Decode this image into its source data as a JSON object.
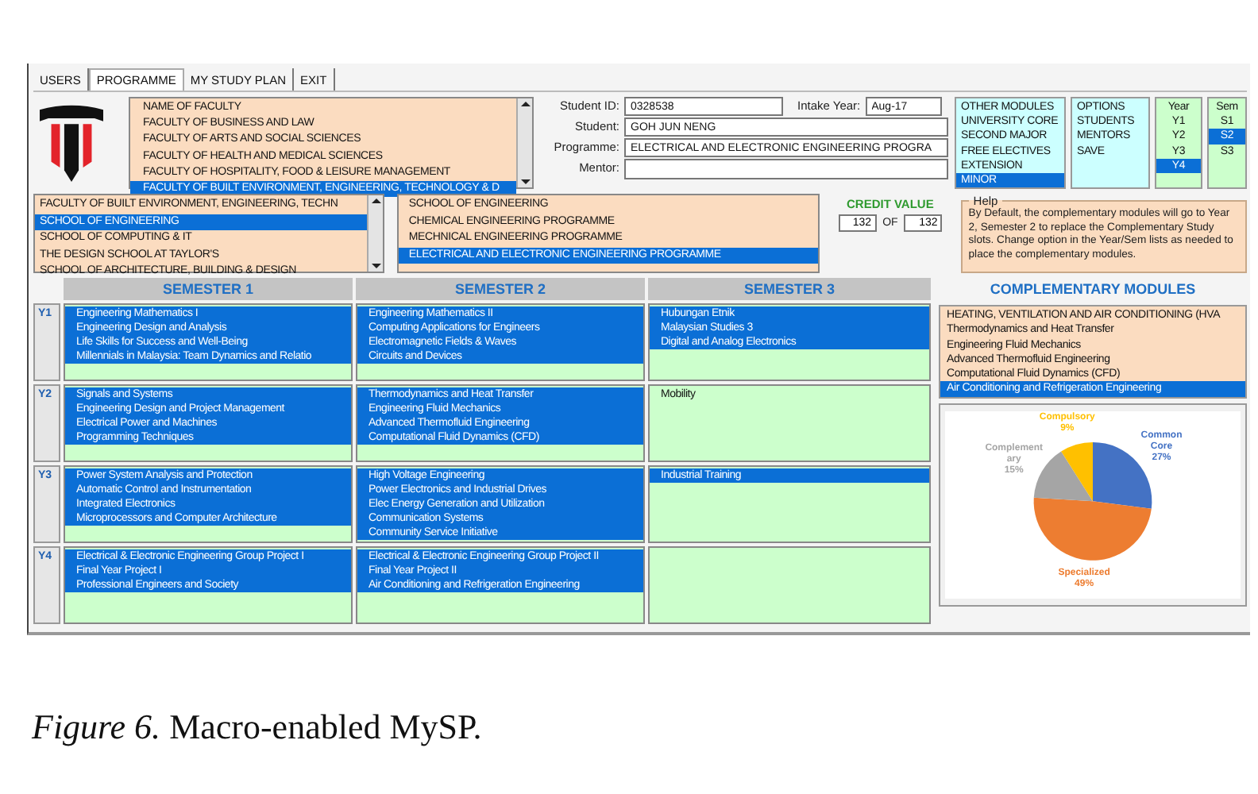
{
  "tabs": [
    {
      "label": "USERS",
      "selected": false
    },
    {
      "label": "PROGRAMME",
      "selected": true
    },
    {
      "label": "MY STUDY PLAN",
      "selected": false
    },
    {
      "label": "EXIT",
      "selected": false
    }
  ],
  "faculty_list": {
    "items": [
      {
        "label": "NAME OF FACULTY",
        "selected": false
      },
      {
        "label": "FACULTY OF BUSINESS AND LAW",
        "selected": false
      },
      {
        "label": "FACULTY OF ARTS AND SOCIAL SCIENCES",
        "selected": false
      },
      {
        "label": "FACULTY OF HEALTH AND MEDICAL SCIENCES",
        "selected": false
      },
      {
        "label": "FACULTY OF HOSPITALITY, FOOD & LEISURE MANAGEMENT",
        "selected": false
      },
      {
        "label": "FACULTY OF BUILT ENVIRONMENT, ENGINEERING, TECHNOLOGY & D",
        "selected": true
      }
    ]
  },
  "student_id": {
    "label": "Student ID:",
    "value": "0328538"
  },
  "intake_year": {
    "label": "Intake Year:",
    "value": "Aug-17"
  },
  "student": {
    "label": "Student:",
    "value": "GOH JUN NENG"
  },
  "programme": {
    "label": "Programme:",
    "value": "ELECTRICAL AND ELECTRONIC ENGINEERING PROGRA"
  },
  "mentor": {
    "label": "Mentor:"
  },
  "option_lists": [
    {
      "kind": "modules",
      "items": [
        {
          "label": "OTHER MODULES",
          "selected": false
        },
        {
          "label": "UNIVERSITY CORE",
          "selected": false
        },
        {
          "label": "SECOND MAJOR",
          "selected": false
        },
        {
          "label": "FREE ELECTIVES",
          "selected": false
        },
        {
          "label": "EXTENSION",
          "selected": false
        },
        {
          "label": "MINOR",
          "selected": true
        }
      ]
    },
    {
      "kind": "options",
      "items": [
        {
          "label": "OPTIONS",
          "selected": false
        },
        {
          "label": "STUDENTS",
          "selected": false
        },
        {
          "label": "MENTORS",
          "selected": false
        },
        {
          "label": "SAVE",
          "selected": false
        }
      ]
    },
    {
      "kind": "year",
      "items": [
        {
          "label": "Year",
          "selected": false
        },
        {
          "label": "Y1",
          "selected": false
        },
        {
          "label": "Y2",
          "selected": false
        },
        {
          "label": "Y3",
          "selected": false
        },
        {
          "label": "Y4",
          "selected": true
        }
      ]
    },
    {
      "kind": "sem",
      "items": [
        {
          "label": "Sem",
          "selected": false
        },
        {
          "label": "S1",
          "selected": false
        },
        {
          "label": "S2",
          "selected": true
        },
        {
          "label": "S3",
          "selected": false
        }
      ]
    }
  ],
  "school_list": {
    "items": [
      {
        "label": "FACULTY OF BUILT ENVIRONMENT, ENGINEERING, TECHN",
        "selected": false
      },
      {
        "label": "SCHOOL OF ENGINEERING",
        "selected": true
      },
      {
        "label": "SCHOOL OF COMPUTING & IT",
        "selected": false
      },
      {
        "label": "THE DESIGN SCHOOL AT TAYLOR'S",
        "selected": false
      },
      {
        "label": "SCHOOL OF ARCHITECTURE, BUILDING & DESIGN",
        "selected": false
      }
    ]
  },
  "programme_list": {
    "items": [
      {
        "label": "SCHOOL OF ENGINEERING",
        "selected": false
      },
      {
        "label": "CHEMICAL ENGINEERING PROGRAMME",
        "selected": false
      },
      {
        "label": "MECHNICAL ENGINEERING PROGRAMME",
        "selected": false
      },
      {
        "label": "ELECTRICAL AND ELECTRONIC ENGINEERING PROGRAMME",
        "selected": true
      }
    ]
  },
  "credit_value": {
    "label": "CREDIT VALUE",
    "earned": "132",
    "separator": "OF",
    "required": "132"
  },
  "help": {
    "title": "Help",
    "text": "By Default, the complementary modules will go to Year 2, Semester 2 to replace the Complementary Study slots. Change option in the Year/Sem lists as needed to place the complementary modules."
  },
  "plan": {
    "semesters": [
      "SEMESTER 1",
      "SEMESTER 2",
      "SEMESTER 3"
    ],
    "years": [
      {
        "label": "Y1",
        "cells": [
          [
            {
              "name": "Engineering Mathematics I",
              "selected": true
            },
            {
              "name": "Engineering Design and Analysis",
              "selected": true
            },
            {
              "name": "Life Skills for Success and Well-Being",
              "selected": true
            },
            {
              "name": "Millennials in Malaysia: Team Dynamics and Relatio",
              "selected": true
            }
          ],
          [
            {
              "name": "Engineering Mathematics II",
              "selected": true
            },
            {
              "name": "Computing Applications for Engineers",
              "selected": true
            },
            {
              "name": "Electromagnetic Fields & Waves",
              "selected": true
            },
            {
              "name": "Circuits and Devices",
              "selected": true
            }
          ],
          [
            {
              "name": "Hubungan Etnik",
              "selected": true
            },
            {
              "name": "Malaysian Studies 3",
              "selected": true
            },
            {
              "name": "Digital and Analog Electronics",
              "selected": true
            }
          ]
        ]
      },
      {
        "label": "Y2",
        "cells": [
          [
            {
              "name": "Signals and Systems",
              "selected": true
            },
            {
              "name": "Engineering Design and Project Management",
              "selected": true
            },
            {
              "name": "Electrical Power and Machines",
              "selected": true
            },
            {
              "name": "Programming Techniques",
              "selected": true
            }
          ],
          [
            {
              "name": "Thermodynamics and Heat Transfer",
              "selected": true
            },
            {
              "name": "Engineering Fluid Mechanics",
              "selected": true
            },
            {
              "name": "Advanced Thermofluid Engineering",
              "selected": true
            },
            {
              "name": "Computational Fluid Dynamics (CFD)",
              "selected": true
            }
          ],
          [
            {
              "name": "Mobility",
              "selected": false
            }
          ]
        ]
      },
      {
        "label": "Y3",
        "cells": [
          [
            {
              "name": "Power System Analysis and Protection",
              "selected": true
            },
            {
              "name": "Automatic Control and Instrumentation",
              "selected": true
            },
            {
              "name": "Integrated Electronics",
              "selected": true
            },
            {
              "name": "Microprocessors and Computer Architecture",
              "selected": true
            }
          ],
          [
            {
              "name": "High Voltage Engineering",
              "selected": true
            },
            {
              "name": "Power Electronics and Industrial Drives",
              "selected": true
            },
            {
              "name": "Elec Energy Generation and Utilization",
              "selected": true
            },
            {
              "name": "Communication Systems",
              "selected": true
            },
            {
              "name": "Community Service Initiative",
              "selected": true
            }
          ],
          [
            {
              "name": "Industrial Training",
              "selected": true
            }
          ]
        ]
      },
      {
        "label": "Y4",
        "cells": [
          [
            {
              "name": "Electrical & Electronic Engineering Group Project I",
              "selected": true
            },
            {
              "name": "Final Year Project I",
              "selected": true
            },
            {
              "name": "Professional Engineers and Society",
              "selected": true
            }
          ],
          [
            {
              "name": "Electrical & Electronic Engineering Group Project II",
              "selected": true
            },
            {
              "name": "Final Year Project II",
              "selected": true
            },
            {
              "name": "Air Conditioning and Refrigeration Engineering",
              "selected": true
            }
          ],
          []
        ]
      }
    ]
  },
  "complementary": {
    "title": "COMPLEMENTARY MODULES",
    "items": [
      {
        "label": "HEATING, VENTILATION AND AIR CONDITIONING (HVA",
        "selected": false
      },
      {
        "label": "Thermodynamics and Heat Transfer",
        "selected": false
      },
      {
        "label": "Engineering Fluid Mechanics",
        "selected": false
      },
      {
        "label": "Advanced Thermofluid Engineering",
        "selected": false
      },
      {
        "label": "Computational Fluid Dynamics (CFD)",
        "selected": false
      },
      {
        "label": "Air Conditioning and Refrigeration Engineering",
        "selected": true
      }
    ],
    "chart_data": {
      "type": "pie",
      "categories": [
        "Common Core",
        "Specialized",
        "Complementary",
        "Compulsory"
      ],
      "values": [
        27,
        49,
        15,
        9
      ],
      "colors": [
        "#4472c4",
        "#ed7d31",
        "#a5a5a5",
        "#ffc000"
      ],
      "value_labels": [
        "27%",
        "49%",
        "15%",
        "9%"
      ]
    }
  },
  "caption": "*Figure 6.* Macro-enabled MySP."
}
